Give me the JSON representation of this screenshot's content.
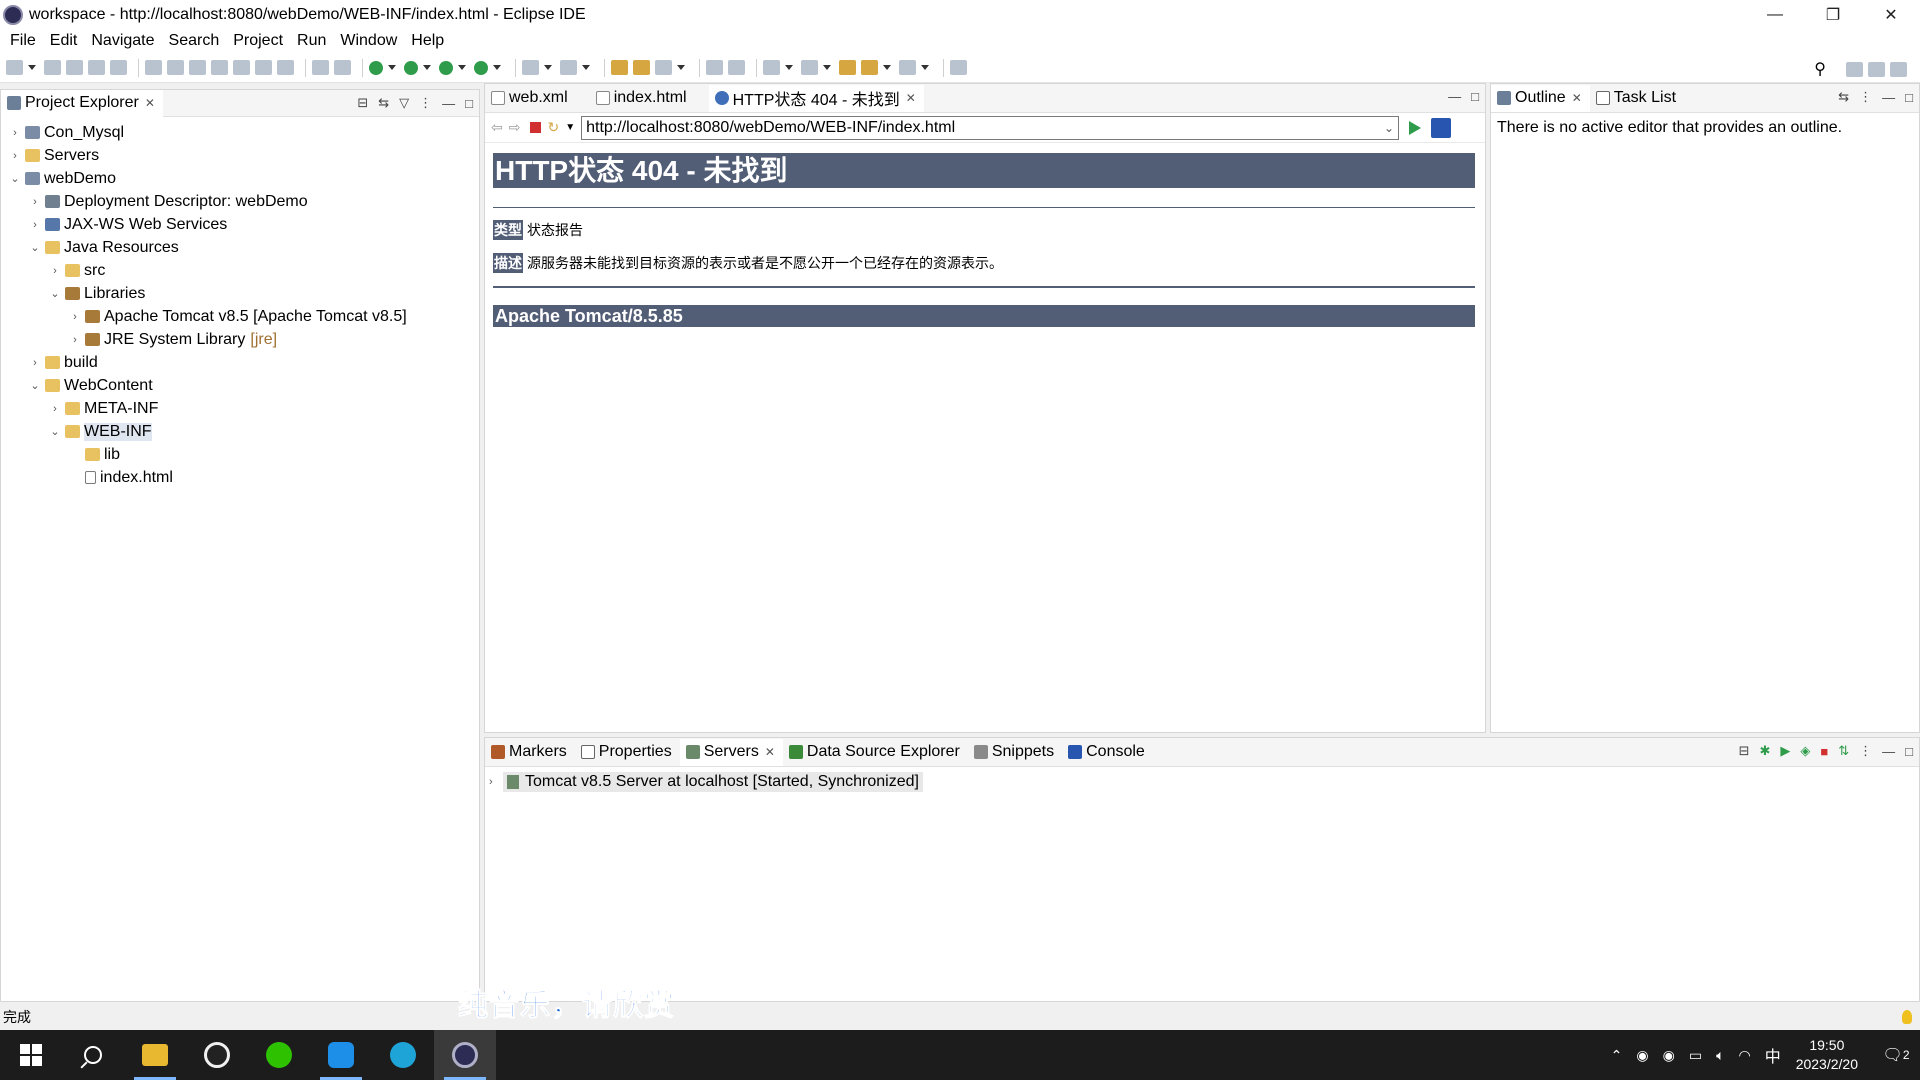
{
  "window": {
    "title": "workspace - http://localhost:8080/webDemo/WEB-INF/index.html - Eclipse IDE",
    "minimize": "—",
    "restore": "❐",
    "close": "✕"
  },
  "menu": [
    "File",
    "Edit",
    "Navigate",
    "Search",
    "Project",
    "Run",
    "Window",
    "Help"
  ],
  "project_explorer": {
    "title": "Project Explorer",
    "tree": [
      {
        "label": "Con_Mysql",
        "chev": "›"
      },
      {
        "label": "Servers",
        "chev": "›"
      },
      {
        "label": "webDemo",
        "chev": "⌄"
      },
      {
        "label": "Deployment Descriptor: webDemo",
        "chev": "›"
      },
      {
        "label": "JAX-WS Web Services",
        "chev": "›"
      },
      {
        "label": "Java Resources",
        "chev": "⌄"
      },
      {
        "label": "src",
        "chev": "›"
      },
      {
        "label": "Libraries",
        "chev": "⌄"
      },
      {
        "label": "Apache Tomcat v8.5 [Apache Tomcat v8.5]",
        "chev": "›"
      },
      {
        "label": "JRE System Library",
        "deco": "[jre]",
        "chev": "›"
      },
      {
        "label": "build",
        "chev": "›"
      },
      {
        "label": "WebContent",
        "chev": "⌄"
      },
      {
        "label": "META-INF",
        "chev": "›"
      },
      {
        "label": "WEB-INF",
        "chev": "⌄"
      },
      {
        "label": "lib",
        "chev": ""
      },
      {
        "label": "index.html",
        "chev": ""
      }
    ]
  },
  "editor": {
    "tabs": [
      {
        "label": "web.xml"
      },
      {
        "label": "index.html"
      },
      {
        "label": "HTTP状态 404 - 未找到"
      }
    ],
    "url": "http://localhost:8080/webDemo/WEB-INF/index.html",
    "page": {
      "heading": "HTTP状态 404 - 未找到",
      "type_key": "类型",
      "type_value": "状态报告",
      "desc_key": "描述",
      "desc_value": "源服务器未能找到目标资源的表示或者是不愿公开一个已经存在的资源表示。",
      "footer": "Apache Tomcat/8.5.85"
    }
  },
  "outline": {
    "tabs": [
      {
        "label": "Outline"
      },
      {
        "label": "Task List"
      }
    ],
    "message": "There is no active editor that provides an outline."
  },
  "bottom": {
    "tabs": [
      {
        "label": "Markers"
      },
      {
        "label": "Properties"
      },
      {
        "label": "Servers"
      },
      {
        "label": "Data Source Explorer"
      },
      {
        "label": "Snippets"
      },
      {
        "label": "Console"
      }
    ],
    "server": "Tomcat v8.5 Server at localhost  [Started, Synchronized]"
  },
  "status": {
    "text": "完成",
    "caption": "纯音乐，请欣赏"
  },
  "taskbar": {
    "ime": "中",
    "time": "19:50",
    "date": "2023/2/20",
    "notifications": "2"
  },
  "colors": {
    "tomcat_bar": "#525d76",
    "selection": "#dfe6ef",
    "caption": "#1f6fe0"
  }
}
